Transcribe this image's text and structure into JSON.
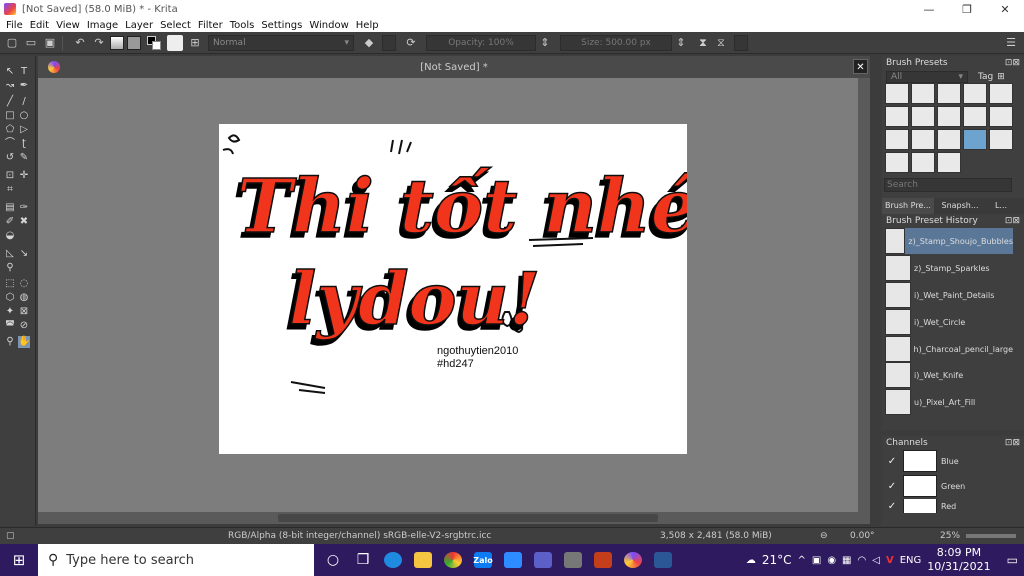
{
  "window": {
    "title": "[Not Saved]  (58.0 MiB)  * - Krita",
    "btn_minimize": "—",
    "btn_maximize": "❐",
    "btn_close": "✕"
  },
  "menu": [
    "File",
    "Edit",
    "View",
    "Image",
    "Layer",
    "Select",
    "Filter",
    "Tools",
    "Settings",
    "Window",
    "Help"
  ],
  "toolbar": {
    "blend_mode": "Normal",
    "opacity": "Opacity: 100%",
    "size": "Size: 500.00 px"
  },
  "document": {
    "tab_title": "[Not Saved]  *",
    "close_label": "✕"
  },
  "artwork": {
    "line1": "Thi tốt nhé",
    "line2": "lydou!",
    "credit_1": "ngothuytien2010",
    "credit_2": "#hd247"
  },
  "brush_presets": {
    "title": "Brush Presets",
    "filter": "All",
    "tag_label": "Tag",
    "search_placeholder": "Search",
    "tabs": [
      "Brush Pre...",
      "Snapsh...",
      "L..."
    ]
  },
  "history": {
    "title": "Brush Preset History",
    "items": [
      "z)_Stamp_Shoujo_Bubbles",
      "z)_Stamp_Sparkles",
      "i)_Wet_Paint_Details",
      "i)_Wet_Circle",
      "h)_Charcoal_pencil_large",
      "i)_Wet_Knife",
      "u)_Pixel_Art_Fill"
    ]
  },
  "channels": {
    "title": "Channels",
    "items": [
      "Blue",
      "Green",
      "Red"
    ]
  },
  "status": {
    "colorspace": "RGB/Alpha (8-bit integer/channel)  sRGB-elle-V2-srgbtrc.icc",
    "dimensions": "3,508 x 2,481 (58.0 MiB)",
    "rotation": "0.00°",
    "zoom": "25%"
  },
  "taskbar": {
    "search_placeholder": "Type here to search",
    "weather": "21°C",
    "lang": "ENG",
    "time": "8:09 PM",
    "date": "10/31/2021",
    "zalo_label": "Zalo"
  },
  "colors": {
    "lettering_red": "#f0341a",
    "accent_blue": "#5a7797",
    "taskbar_purple": "#2e1a5e"
  }
}
